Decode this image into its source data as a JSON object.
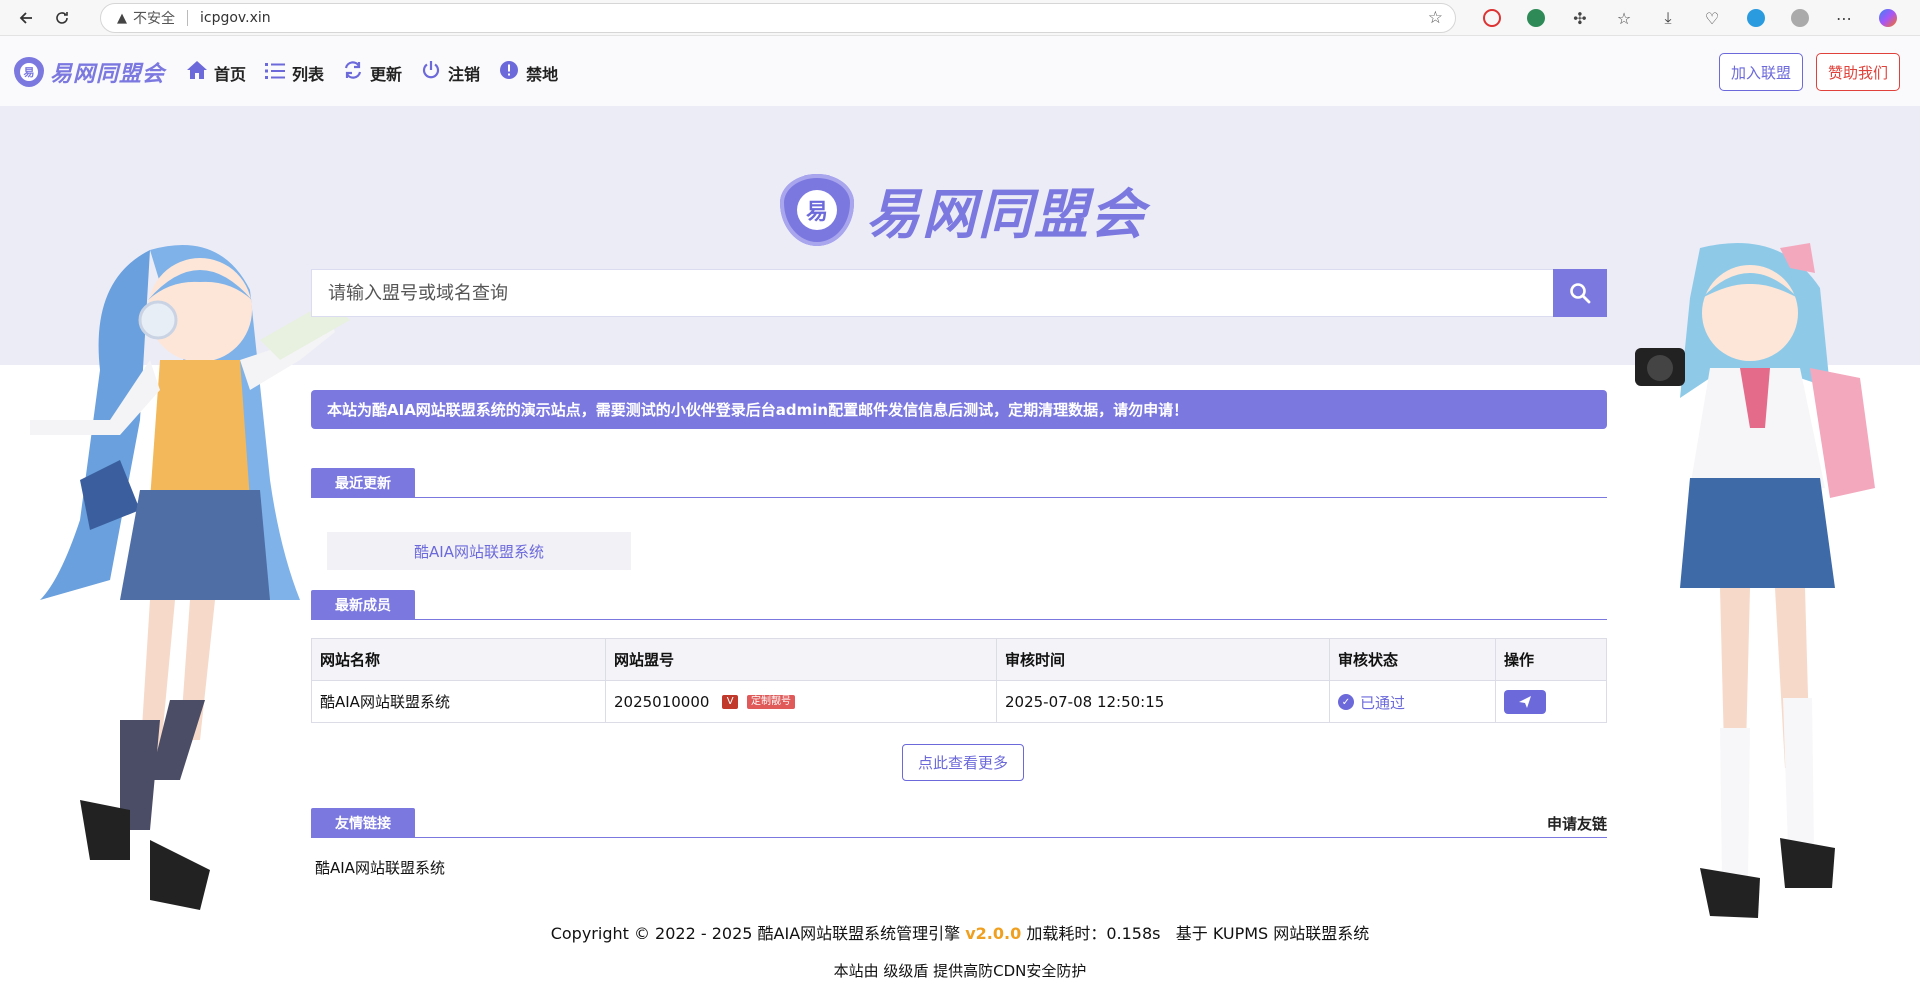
{
  "browser": {
    "insecure_label": "不安全",
    "url": "icpgov.xin"
  },
  "site": {
    "logo_text": "易网同盟会",
    "nav": [
      {
        "label": "首页",
        "icon": "home-icon"
      },
      {
        "label": "列表",
        "icon": "list-icon"
      },
      {
        "label": "更新",
        "icon": "refresh-icon"
      },
      {
        "label": "注销",
        "icon": "power-icon"
      },
      {
        "label": "禁地",
        "icon": "alert-icon"
      }
    ],
    "join_label": "加入联盟",
    "donate_label": "赞助我们"
  },
  "hero": {
    "logo_text": "易网同盟会",
    "shield_char": "易",
    "search_placeholder": "请输入盟号或域名查询"
  },
  "notice": "本站为酷AIA网站联盟系统的演示站点，需要测试的小伙伴登录后台admin配置邮件发信信息后测试，定期清理数据，请勿申请！",
  "recent_updates": {
    "title": "最近更新",
    "items": [
      "酷AIA网站联盟系统"
    ]
  },
  "new_members": {
    "title": "最新成员",
    "headers": [
      "网站名称",
      "网站盟号",
      "审核时间",
      "审核状态",
      "操作"
    ],
    "rows": [
      {
        "name": "酷AIA网站联盟系统",
        "number": "2025010000",
        "badge_v": "V",
        "badge_custom": "定制靓号",
        "time": "2025-07-08 12:50:15",
        "status": "已通过"
      }
    ],
    "more_label": "点此查看更多"
  },
  "friend_links": {
    "title": "友情链接",
    "apply_label": "申请友链",
    "items": [
      "酷AIA网站联盟系统"
    ]
  },
  "footer": {
    "copyright_prefix": "Copyright © 2022 - 2025 酷AIA网站联盟系统管理引擎",
    "version": "v2.0.0",
    "load_time": "加载耗时：0.158s",
    "based_on": "基于 KUPMS 网站联盟系统",
    "cdn_line": "本站由 级级盾 提供高防CDN安全防护"
  },
  "colors": {
    "accent": "#7b78e0",
    "danger": "#e0413a",
    "version": "#f0a020"
  }
}
